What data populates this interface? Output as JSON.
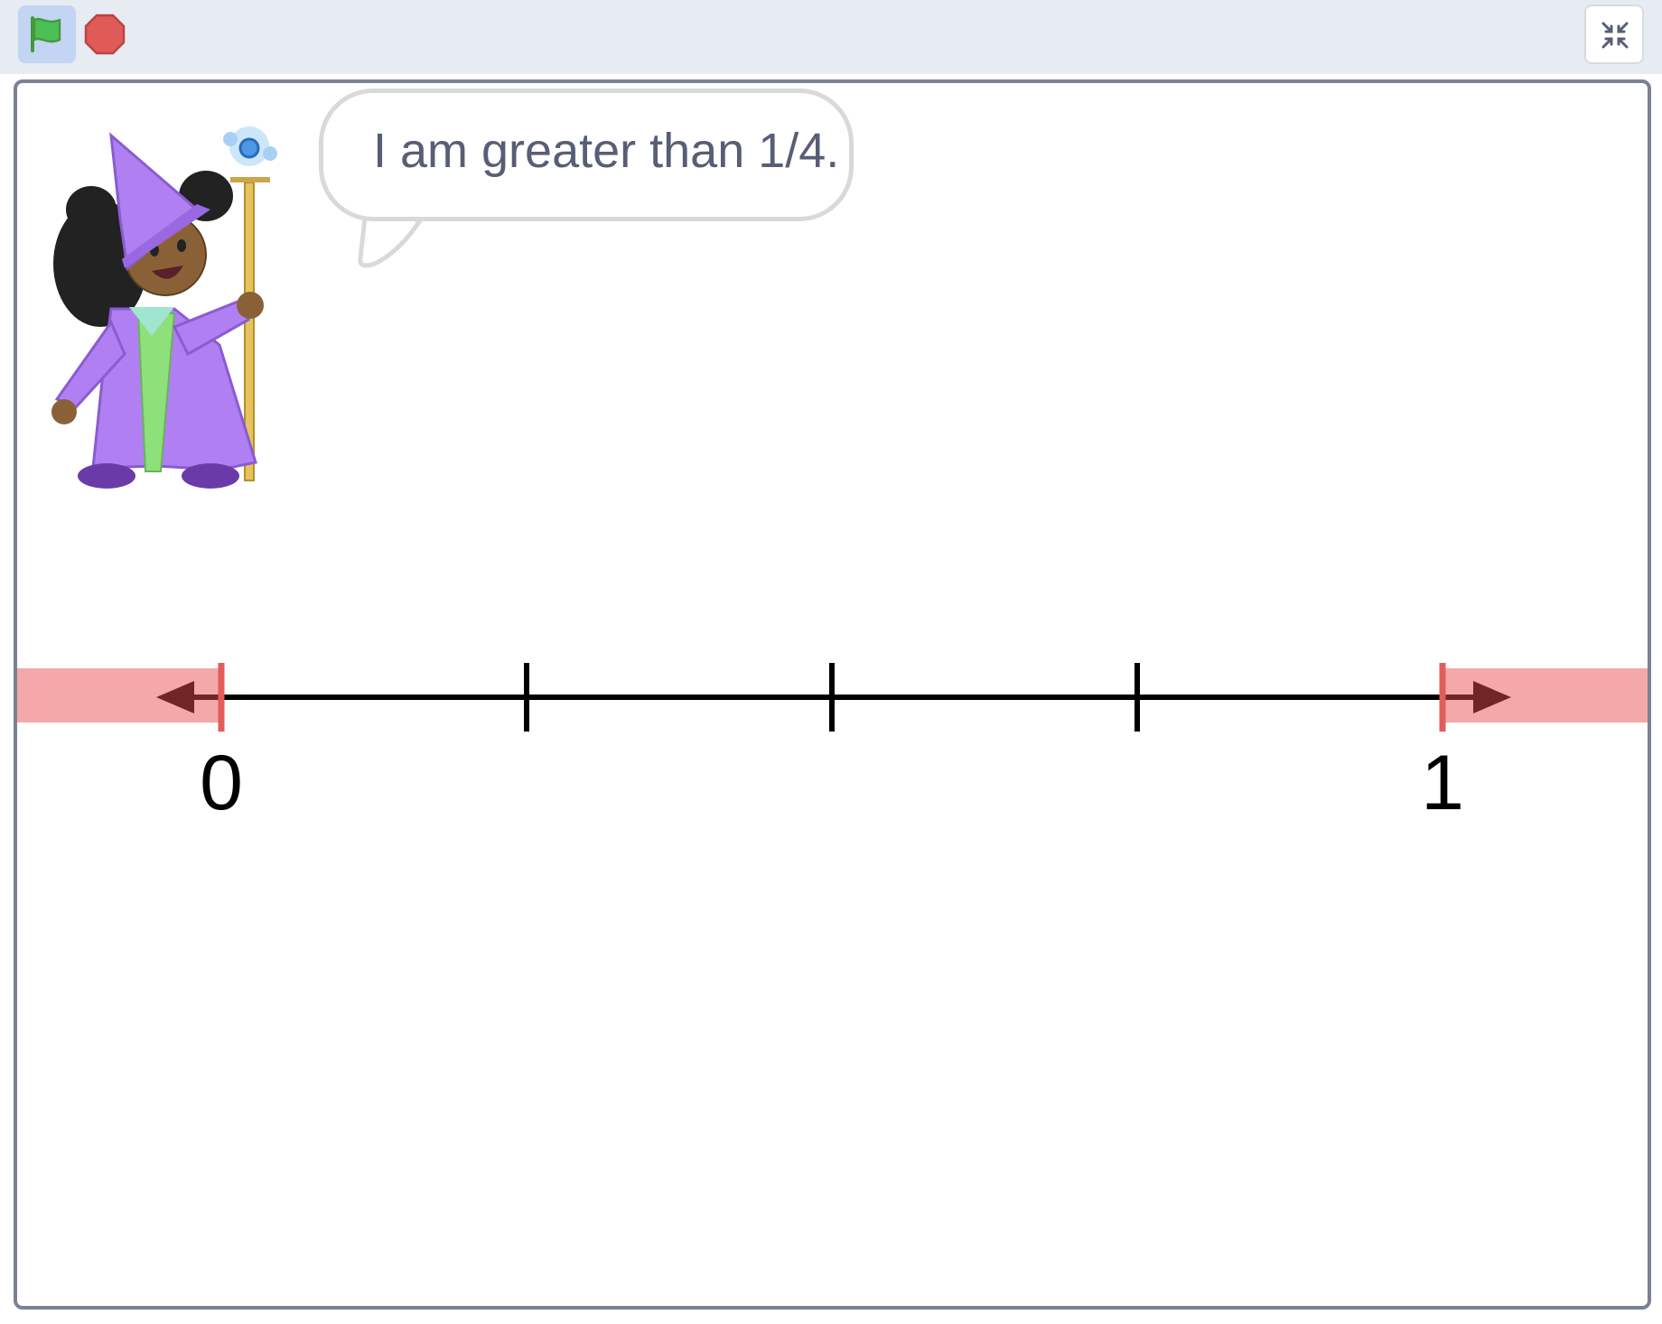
{
  "toolbar": {
    "green_flag_icon": "green-flag-icon",
    "stop_icon": "stop-sign-icon",
    "exit_fullscreen_icon": "exit-fullscreen-icon",
    "flag_active_bg": "#c3d5f3",
    "stop_color": "#e05a57"
  },
  "stage": {
    "speech_bubble": {
      "text": "I am greater than 1/4."
    },
    "sprite": {
      "icon": "wizard-sprite"
    },
    "number_line": {
      "start_label": "0",
      "end_label": "1",
      "ticks": [
        0,
        0.25,
        0.5,
        0.75,
        1
      ],
      "highlight_color": "#f3a9a9",
      "endpoint_marker_color": "#e25c5c"
    }
  }
}
